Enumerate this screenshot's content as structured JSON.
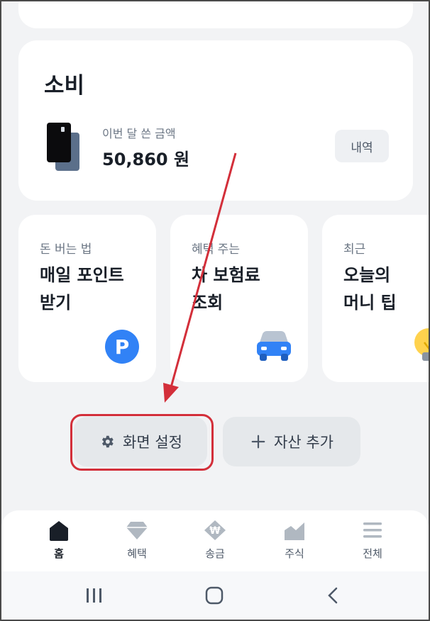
{
  "spending": {
    "title": "소비",
    "label": "이번 달 쓴 금액",
    "amount": "50,860 원",
    "history_button": "내역"
  },
  "promos": [
    {
      "subtitle": "돈 버는 법",
      "title_line1": "매일 포인트",
      "title_line2": "받기",
      "icon": "p-icon",
      "icon_text": "P"
    },
    {
      "subtitle": "혜택 주는",
      "title_line1": "차 보험료",
      "title_line2": "조회",
      "icon": "car-icon"
    },
    {
      "subtitle": "최근",
      "title_line1": "오늘의",
      "title_line2": "머니 팁",
      "icon": "lightbulb-icon"
    }
  ],
  "actions": {
    "screen_settings": "화면 설정",
    "add_asset": "자산 추가"
  },
  "tabs": [
    {
      "label": "홈",
      "icon": "home-icon",
      "active": true
    },
    {
      "label": "혜택",
      "icon": "diamond-icon",
      "active": false
    },
    {
      "label": "송금",
      "icon": "won-icon",
      "active": false
    },
    {
      "label": "주식",
      "icon": "chart-icon",
      "active": false
    },
    {
      "label": "전체",
      "icon": "menu-icon",
      "active": false
    }
  ],
  "system_nav": [
    "recent-apps-icon",
    "home-circle-icon",
    "back-icon"
  ],
  "colors": {
    "accent_blue": "#3182f6",
    "annotation_red": "#d32f3a",
    "background": "#f2f3f5"
  }
}
